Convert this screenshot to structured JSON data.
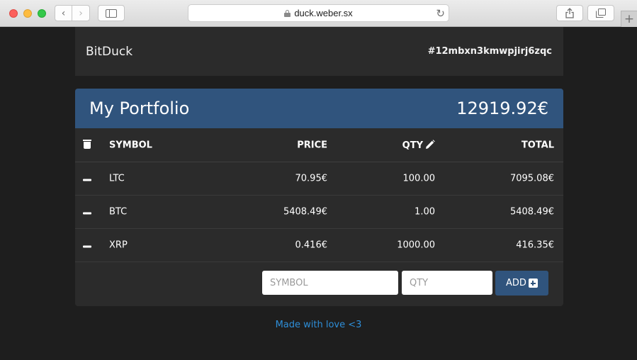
{
  "browser": {
    "url": "duck.weber.sx"
  },
  "app": {
    "brand": "BitDuck",
    "wallet_id": "#12mbxn3kmwpjirj6zqc"
  },
  "portfolio": {
    "title": "My Portfolio",
    "total": "12919.92€",
    "columns": {
      "symbol": "SYMBOL",
      "price": "PRICE",
      "qty": "QTY",
      "total": "TOTAL"
    },
    "rows": [
      {
        "symbol": "LTC",
        "price": "70.95€",
        "qty": "100.00",
        "total": "7095.08€"
      },
      {
        "symbol": "BTC",
        "price": "5408.49€",
        "qty": "1.00",
        "total": "5408.49€"
      },
      {
        "symbol": "XRP",
        "price": "0.416€",
        "qty": "1000.00",
        "total": "416.35€"
      }
    ],
    "add_form": {
      "symbol_placeholder": "SYMBOL",
      "qty_placeholder": "QTY",
      "add_label": "ADD"
    }
  },
  "footer": {
    "link": "Made with love <3"
  },
  "colors": {
    "accent": "#30547d",
    "link": "#2e8ed8",
    "panel": "#2b2b2b",
    "background": "#1e1e1e"
  }
}
